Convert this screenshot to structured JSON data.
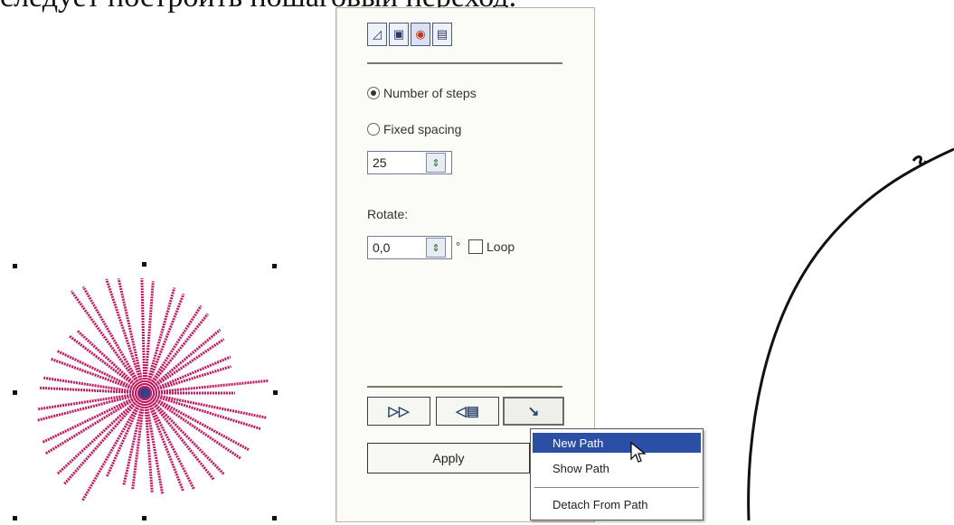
{
  "document": {
    "text_fragment": "следует построить пошаговый переход."
  },
  "blend_panel": {
    "tabs": [
      {
        "icon": "blend-steps-icon",
        "glyph": "◿"
      },
      {
        "icon": "blend-acceleration-icon",
        "glyph": "▣"
      },
      {
        "icon": "blend-color-icon",
        "glyph": "◉"
      },
      {
        "icon": "blend-misc-icon",
        "glyph": "▤"
      }
    ],
    "number_of_steps_label": "Number of steps",
    "fixed_spacing_label": "Fixed spacing",
    "selected_mode": "Number of steps",
    "steps_value": "25",
    "rotate_label": "Rotate:",
    "rotate_value": "0,0",
    "degree_symbol": "°",
    "loop_label": "Loop",
    "loop_checked": false,
    "start_button_glyph": "▷▷",
    "end_button_glyph": "◁▤",
    "path_button_glyph": "↘",
    "apply_label": "Apply"
  },
  "path_menu": {
    "items": [
      "New Path",
      "Show Path",
      "Detach From Path"
    ],
    "highlighted": "New Path"
  },
  "colors": {
    "star_stroke": "#c0185e",
    "star_center": "#3b3f88",
    "menu_highlight": "#2a4fa5"
  }
}
